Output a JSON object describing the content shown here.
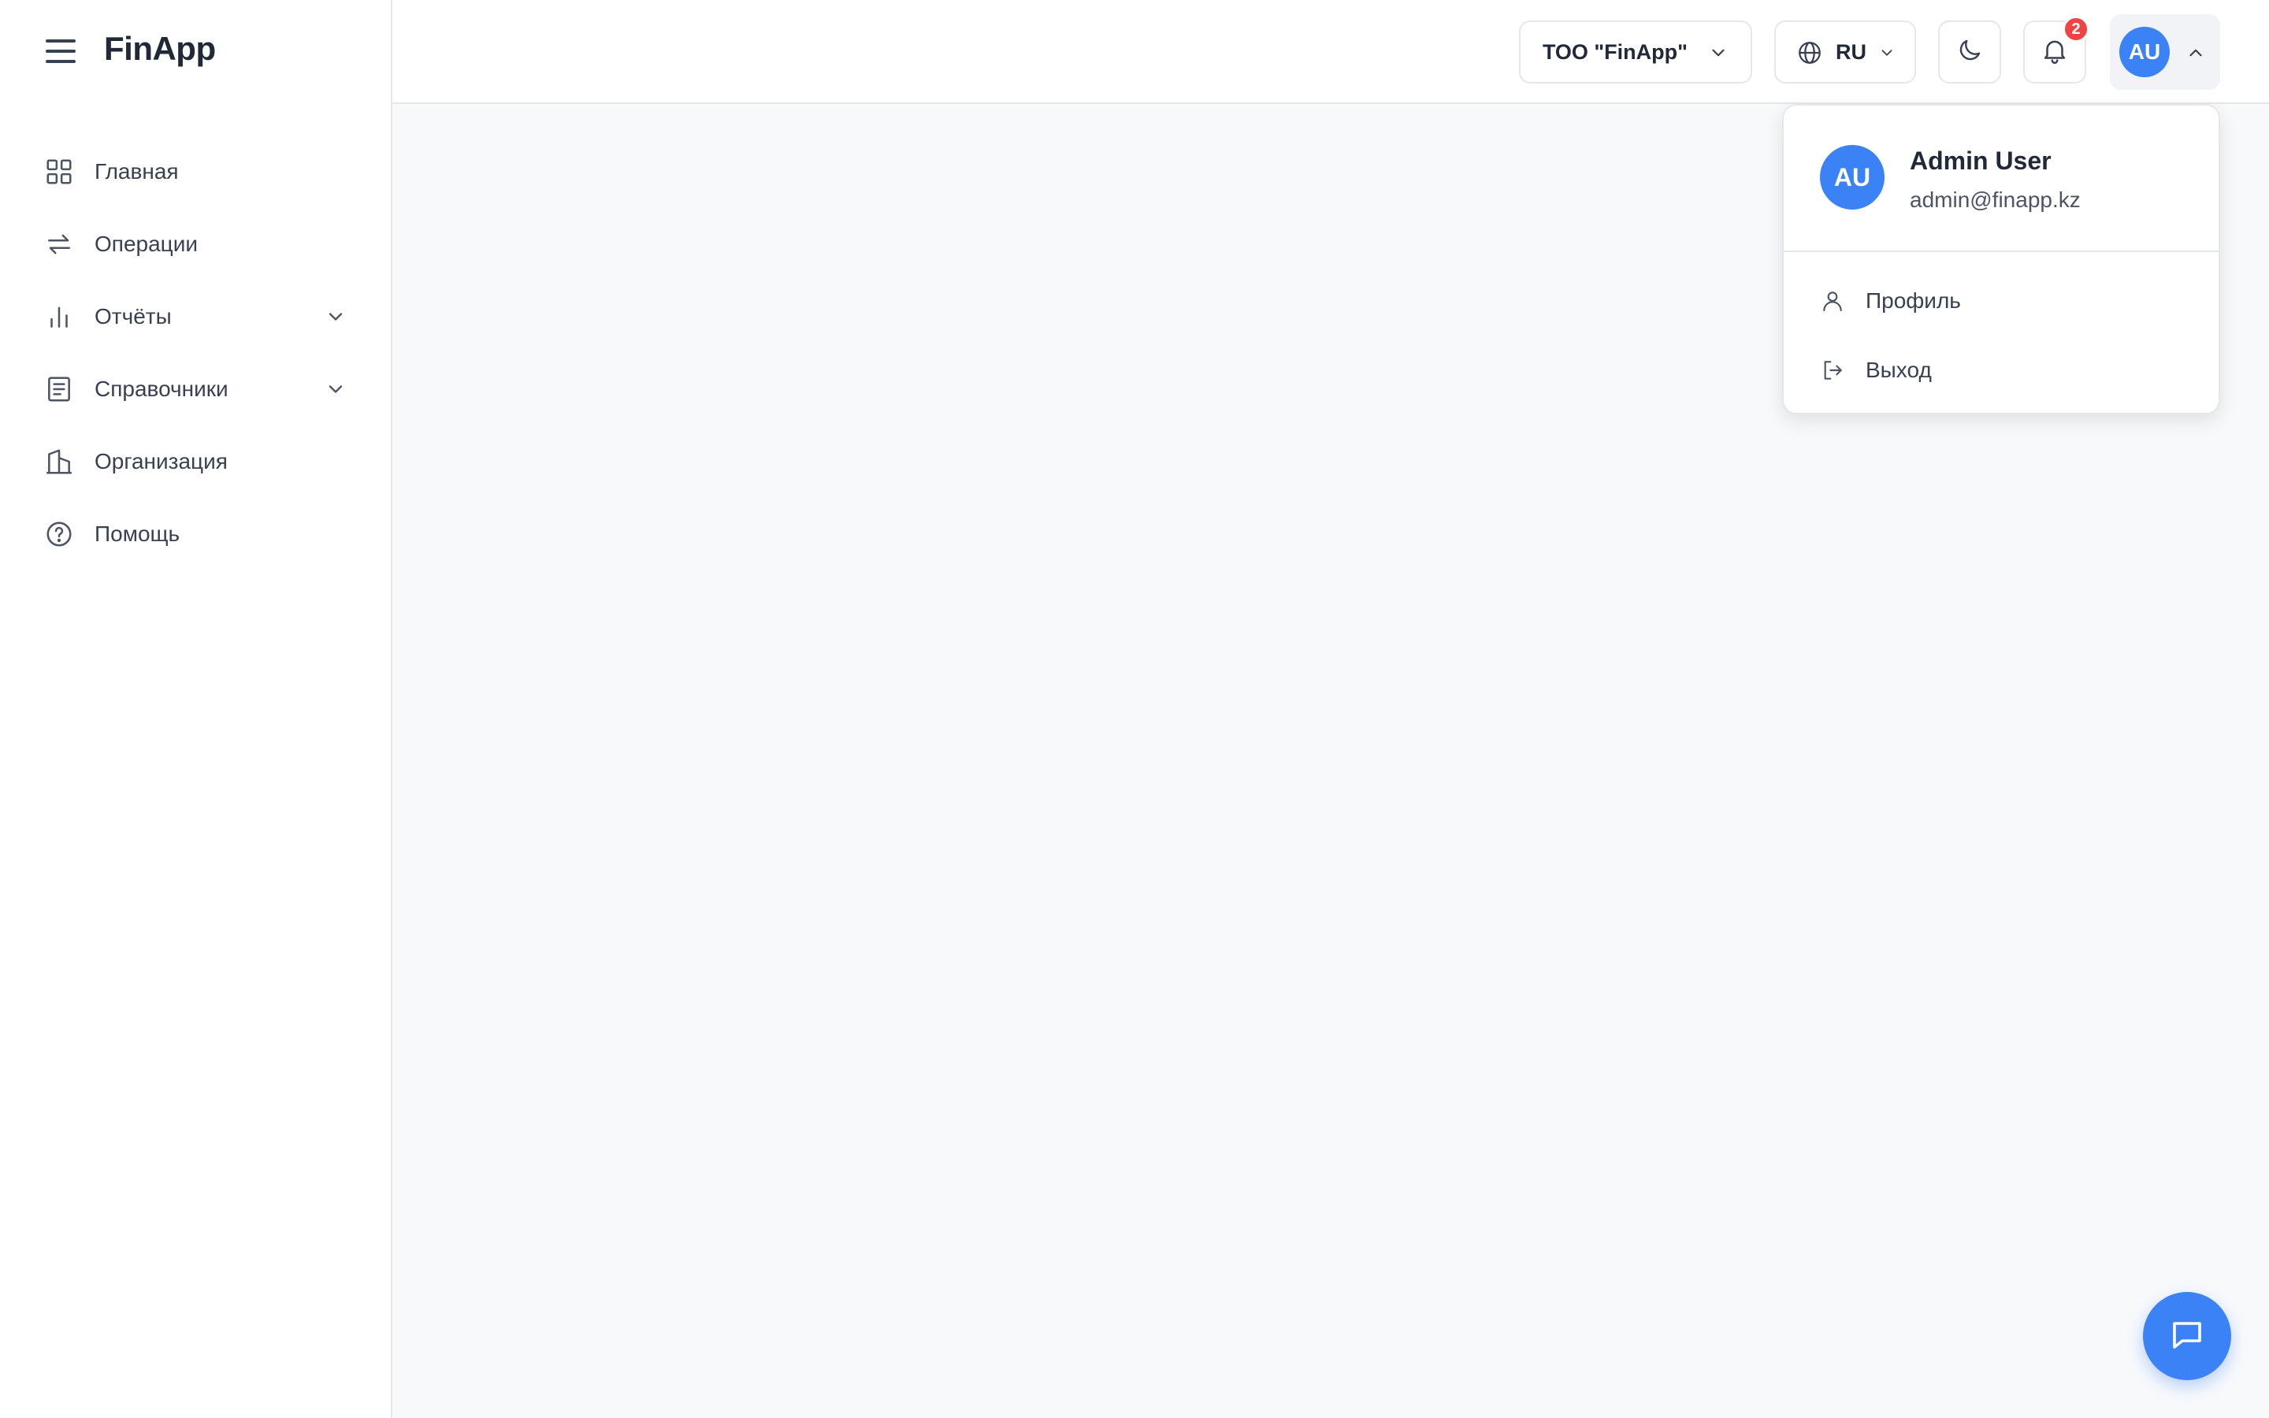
{
  "app": {
    "brand": "FinApp"
  },
  "sidebar": {
    "items": [
      {
        "label": "Главная",
        "icon": "grid-icon",
        "expandable": false
      },
      {
        "label": "Операции",
        "icon": "arrows-swap-icon",
        "expandable": false
      },
      {
        "label": "Отчёты",
        "icon": "bar-chart-icon",
        "expandable": true
      },
      {
        "label": "Справочники",
        "icon": "book-icon",
        "expandable": true
      },
      {
        "label": "Организация",
        "icon": "building-icon",
        "expandable": false
      },
      {
        "label": "Помощь",
        "icon": "help-circle-icon",
        "expandable": false
      }
    ]
  },
  "header": {
    "org_selector": "ТОО \"FinApp\"",
    "language": "RU",
    "notifications_count": "2",
    "user_initials": "AU"
  },
  "user_menu": {
    "initials": "AU",
    "name": "Admin User",
    "email": "admin@finapp.kz",
    "items": [
      {
        "label": "Профиль",
        "icon": "user-icon"
      },
      {
        "label": "Выход",
        "icon": "logout-icon"
      }
    ]
  },
  "colors": {
    "accent": "#3b82f6",
    "badge": "#ef4444",
    "background": "#f8f9fb",
    "sidebar_bg": "#ffffff"
  }
}
